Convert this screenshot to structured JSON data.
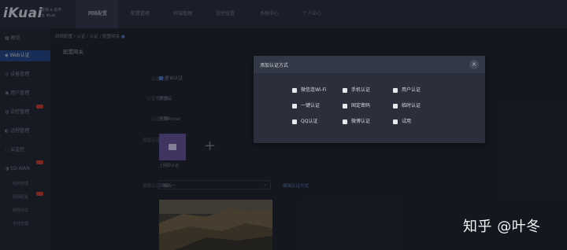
{
  "logo": {
    "text": "iKuai",
    "tagline": "爱快 e 云平台 iKuai"
  },
  "nav": {
    "items": [
      {
        "label": "网络配置",
        "active": true
      },
      {
        "label": "配置管理",
        "active": false
      },
      {
        "label": "终端管理",
        "active": false
      },
      {
        "label": "流控设置",
        "active": false
      },
      {
        "label": "系统中心",
        "active": false
      },
      {
        "label": "帮助中心",
        "active": false
      },
      {
        "label": "个人中心",
        "active": false
      }
    ]
  },
  "sidebar": {
    "items": [
      {
        "label": "概览",
        "icon": "grid-icon",
        "active": false
      },
      {
        "label": "Web认证",
        "icon": "shield-icon",
        "active": true
      },
      {
        "label": "设备管理",
        "icon": "device-icon",
        "active": false
      },
      {
        "label": "用户管理",
        "icon": "user-icon",
        "active": false
      },
      {
        "label": "流控管理",
        "icon": "flow-icon",
        "active": false,
        "badge": true
      },
      {
        "label": "远程管理",
        "icon": "remote-icon",
        "active": false
      },
      {
        "label": "云监控",
        "icon": "cloud-icon",
        "active": false
      },
      {
        "label": "SD-WAN",
        "icon": "network-icon",
        "active": false,
        "badge": true
      }
    ],
    "sub_items": [
      "组网管理",
      "组网配置",
      "组网状态",
      "专线管理"
    ]
  },
  "breadcrumb": [
    "网络配置",
    "认证 / 认证",
    "配置网关"
  ],
  "section_title": "配置网关",
  "form": {
    "rows": [
      {
        "label": "认证配置",
        "value": "开启认证"
      },
      {
        "label": "认证服务器",
        "value": "爱快云"
      },
      {
        "label": "认证页面",
        "value": "全屏Portal"
      },
      {
        "label": "增加认证方式",
        "value": ""
      },
      {
        "label": "选择认证模板",
        "value": "模板一"
      }
    ],
    "template_card_label": "上网即认证",
    "edit_link": "编辑认证方式"
  },
  "modal": {
    "title": "添加认证方式",
    "close": "×",
    "options": [
      "微信连Wi-Fi",
      "手机认证",
      "用户认证",
      "一键认证",
      "固定密码",
      "临时认证",
      "QQ认证",
      "微博认证",
      "试用"
    ]
  },
  "watermark": "知乎 @叶冬",
  "colors": {
    "accent": "#1f3f7d",
    "modal_bg": "#2b2f3b",
    "template_purple": "#5f4a8c"
  }
}
